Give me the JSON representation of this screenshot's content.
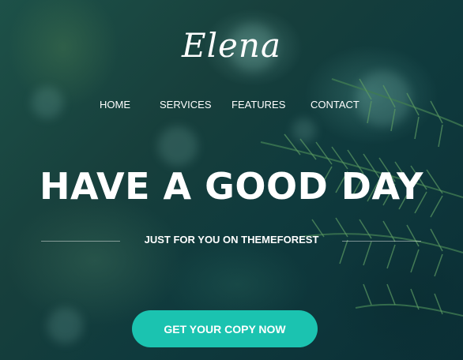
{
  "brand": {
    "logo_text": "Elena"
  },
  "nav": {
    "items": [
      {
        "label": "HOME"
      },
      {
        "label": "SERVICES"
      },
      {
        "label": "FEATURES"
      },
      {
        "label": "CONTACT"
      }
    ]
  },
  "hero": {
    "headline": "HAVE A GOOD DAY",
    "tagline": "JUST FOR YOU ON THEMEFOREST",
    "cta_label": "GET YOUR COPY NOW",
    "background_image": "blurred pine branches, teal-green tones"
  },
  "colors": {
    "accent": "#1bc3b0",
    "text": "#ffffff",
    "background": "#0e3a38"
  }
}
